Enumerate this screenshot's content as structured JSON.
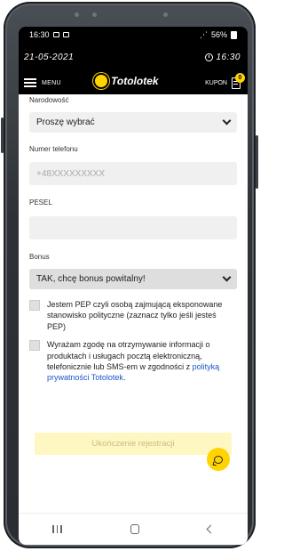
{
  "status_bar": {
    "time": "16:30",
    "right": "56%"
  },
  "date_bar": {
    "date": "21-05-2021",
    "clock": "16:30"
  },
  "header": {
    "menu_label": "MENU",
    "logo_text": "Totolotek",
    "coupon_label": "KUPON",
    "coupon_count": "0"
  },
  "form": {
    "nationality_label": "Narodowość",
    "nationality_value": "Proszę wybrać",
    "phone_label": "Numer telefonu",
    "phone_placeholder": "+48XXXXXXXXX",
    "pesel_label": "PESEL",
    "pesel_value": "",
    "bonus_label": "Bonus",
    "bonus_value": "TAK, chcę bonus powitalny!",
    "pep_text": "Jestem PEP czyli osobą zajmującą eksponowane stanowisko polityczne (zaznacz tylko jeśli jesteś PEP)",
    "consent_text": "Wyrażam zgodę na otrzymywanie informacji o produktach i usługach pocztą elektroniczną, telefonicznie lub SMS-em w zgodności z",
    "consent_link": "polityką prywatności Totolotek",
    "consent_end": ".",
    "submit_label": "Ukończenie rejestracji"
  },
  "icons": [
    "hamburger-icon",
    "coupon-icon",
    "chat-icon",
    "clock-icon",
    "chevron-down-icon"
  ],
  "colors": {
    "accent": "#ffd400",
    "link": "#1a56c8",
    "submit_bg": "#fff7c2"
  }
}
